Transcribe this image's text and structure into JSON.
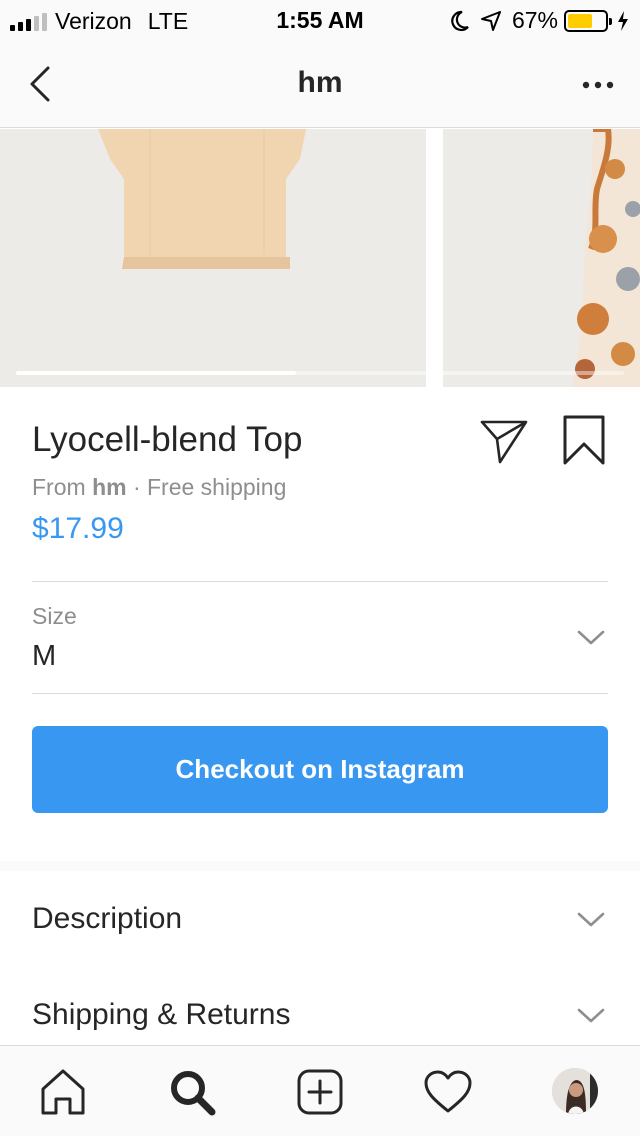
{
  "status_bar": {
    "carrier": "Verizon",
    "network": "LTE",
    "time": "1:55 AM",
    "battery_percent": "67%",
    "battery_level": 0.67,
    "icons": [
      "signal-icon",
      "moon-icon",
      "location-arrow-icon",
      "battery-icon",
      "charging-bolt-icon"
    ]
  },
  "nav": {
    "title": "hm",
    "back_icon": "chevron-left-icon",
    "more_icon": "more-dots-icon"
  },
  "carousel": {
    "slides": [
      "product-image-top",
      "product-image-dress"
    ],
    "progress": 0.46
  },
  "product": {
    "name": "Lyocell-blend Top",
    "from_prefix": "From",
    "seller": "hm",
    "shipping": "· Free shipping",
    "price": "$17.99"
  },
  "size": {
    "label": "Size",
    "value": "M"
  },
  "checkout": {
    "label": "Checkout on Instagram"
  },
  "sections": [
    {
      "title": "Description"
    },
    {
      "title": "Shipping & Returns"
    }
  ],
  "tab_bar": {
    "tabs": [
      "home-icon",
      "search-icon",
      "add-post-icon",
      "heart-icon",
      "profile-avatar"
    ]
  },
  "colors": {
    "accent": "#3897f0",
    "text": "#262626",
    "secondary": "#8e8e8e",
    "divider": "#dbdbdb",
    "battery": "#ffcc00"
  }
}
